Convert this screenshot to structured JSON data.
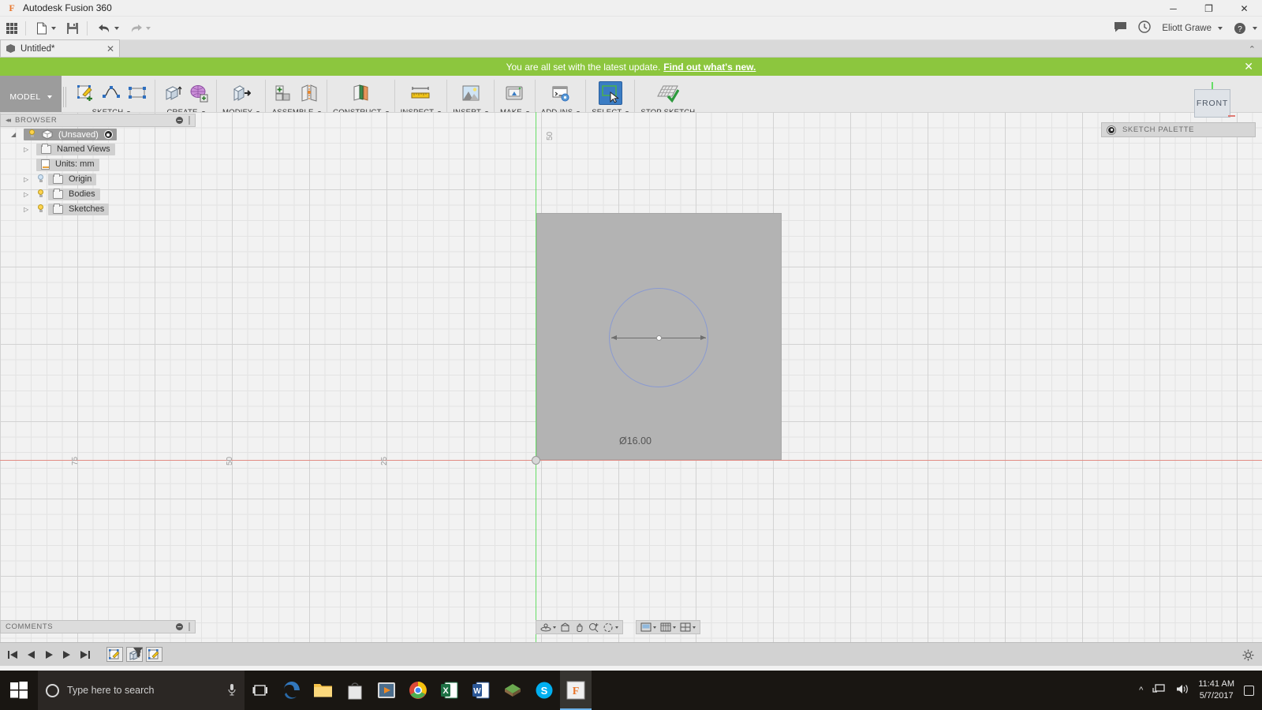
{
  "window": {
    "app_title": "Autodesk Fusion 360",
    "app_icon": "F",
    "minimize": "─",
    "maximize": "❐",
    "close": "✕"
  },
  "quick_access": {
    "apps_grid": "apps-grid-icon",
    "new_file": "new-file-icon",
    "save": "save-icon",
    "undo": "undo-icon",
    "redo": "redo-icon",
    "chat_icon": "chat-icon",
    "job_status_icon": "clock-icon",
    "user_name": "Eliott Grawe",
    "help_icon": "help-icon"
  },
  "document_tab": {
    "name": "Untitled*",
    "close": "✕",
    "collapse_chevron": "⌃"
  },
  "notification": {
    "message": "You are all set with the latest update.",
    "link": "Find out what's new.",
    "close": "✕"
  },
  "ribbon": {
    "workspace": "MODEL",
    "panels": [
      {
        "label": "SKETCH",
        "has_dropdown": true,
        "tools": [
          "create-sketch-icon",
          "spline-icon",
          "rectangle-icon"
        ]
      },
      {
        "label": "CREATE",
        "has_dropdown": true,
        "tools": [
          "extrude-icon",
          "create-form-icon"
        ]
      },
      {
        "label": "MODIFY",
        "has_dropdown": true,
        "tools": [
          "press-pull-icon"
        ]
      },
      {
        "label": "ASSEMBLE",
        "has_dropdown": true,
        "tools": [
          "new-component-icon",
          "joint-icon"
        ]
      },
      {
        "label": "CONSTRUCT",
        "has_dropdown": true,
        "tools": [
          "offset-plane-icon"
        ]
      },
      {
        "label": "INSPECT",
        "has_dropdown": true,
        "tools": [
          "measure-icon"
        ]
      },
      {
        "label": "INSERT",
        "has_dropdown": true,
        "tools": [
          "insert-image-icon"
        ]
      },
      {
        "label": "MAKE",
        "has_dropdown": true,
        "tools": [
          "3d-print-icon"
        ]
      },
      {
        "label": "ADD-INS",
        "has_dropdown": true,
        "tools": [
          "scripts-addins-icon"
        ]
      },
      {
        "label": "SELECT",
        "has_dropdown": true,
        "tools": [
          "select-window-icon"
        ],
        "selected": true
      },
      {
        "label": "STOP SKETCH",
        "has_dropdown": false,
        "tools": [
          "stop-sketch-icon"
        ]
      }
    ]
  },
  "browser": {
    "title": "BROWSER",
    "collapse_icon": "double-chevron-left-icon",
    "options_icon": "panel-options-icon",
    "tree": [
      {
        "label": "(Unsaved)",
        "expander": "◢",
        "icon": "component-cube-icon",
        "root": true,
        "radio": true
      },
      {
        "label": "Named Views",
        "expander": "▷",
        "icon": "folder-icon",
        "bulb": false
      },
      {
        "label": "Units: mm",
        "expander": "",
        "icon": "units-document-icon",
        "bulb": false
      },
      {
        "label": "Origin",
        "expander": "▷",
        "icon": "folder-icon",
        "bulb": true,
        "bulb_off": true
      },
      {
        "label": "Bodies",
        "expander": "▷",
        "icon": "folder-icon",
        "bulb": true,
        "bulb_off": false
      },
      {
        "label": "Sketches",
        "expander": "▷",
        "icon": "folder-icon",
        "bulb": true,
        "bulb_off": false
      }
    ]
  },
  "sketch_palette": {
    "title": "SKETCH PALETTE",
    "icon": "panel-options-icon"
  },
  "view_cube": {
    "face_label": "FRONT"
  },
  "canvas": {
    "dimension_label": "Ø16.00",
    "axis_labels_x": [
      "75",
      "50",
      "25"
    ],
    "axis_label_y": "50",
    "x_axis_color": "#e28b84",
    "y_axis_color": "#66dd66",
    "sketch_profile_color": "#8a9ad0",
    "face_color": "#b3b3b3"
  },
  "comments": {
    "title": "COMMENTS",
    "options_icon": "panel-options-icon"
  },
  "navigation_bar": {
    "buttons": [
      {
        "name": "orbit-icon",
        "has_dropdown": true
      },
      {
        "name": "look-at-icon",
        "has_dropdown": false
      },
      {
        "name": "pan-icon",
        "has_dropdown": false
      },
      {
        "name": "zoom-icon",
        "has_dropdown": false
      },
      {
        "name": "fit-icon",
        "has_dropdown": true
      }
    ],
    "display_buttons": [
      {
        "name": "display-settings-icon",
        "has_dropdown": true
      },
      {
        "name": "grid-snaps-icon",
        "has_dropdown": true
      },
      {
        "name": "viewports-icon",
        "has_dropdown": true
      }
    ]
  },
  "timeline": {
    "controls": [
      "go-to-beginning-icon",
      "step-back-icon",
      "play-icon",
      "step-forward-icon",
      "go-to-end-icon"
    ],
    "features": [
      "sketch-feature-icon",
      "extrude-feature-icon",
      "sketch-feature-icon"
    ],
    "settings_icon": "gear-icon"
  },
  "taskbar": {
    "start_icon": "windows-start-icon",
    "search_placeholder": "Type here to search",
    "cortana_icon": "cortana-circle-icon",
    "mic_icon": "microphone-icon",
    "task_view_icon": "task-view-icon",
    "apps": [
      {
        "name": "edge-icon",
        "glyph": "e",
        "color": "#3277bc"
      },
      {
        "name": "file-explorer-icon",
        "glyph": "",
        "color": "#f5c24a"
      },
      {
        "name": "microsoft-store-icon",
        "glyph": "",
        "color": "#e8e8e8"
      },
      {
        "name": "media-player-icon",
        "glyph": "▶",
        "color": "#e08b2a"
      },
      {
        "name": "chrome-icon",
        "glyph": "",
        "color": "#dc4a38"
      },
      {
        "name": "excel-icon",
        "glyph": "X",
        "color": "#1d7044"
      },
      {
        "name": "word-icon",
        "glyph": "W",
        "color": "#2b5797"
      },
      {
        "name": "minecraft-icon",
        "glyph": "",
        "color": "#6aa84f"
      },
      {
        "name": "skype-icon",
        "glyph": "S",
        "color": "#00aff0"
      },
      {
        "name": "fusion360-icon",
        "glyph": "F",
        "color": "#e8762c",
        "active": true
      }
    ],
    "tray": {
      "chevron": "⌃",
      "network_icon": "network-icon",
      "volume_icon": "volume-icon",
      "time": "11:41 AM",
      "date": "5/7/2017",
      "action_center_icon": "action-center-icon"
    }
  }
}
